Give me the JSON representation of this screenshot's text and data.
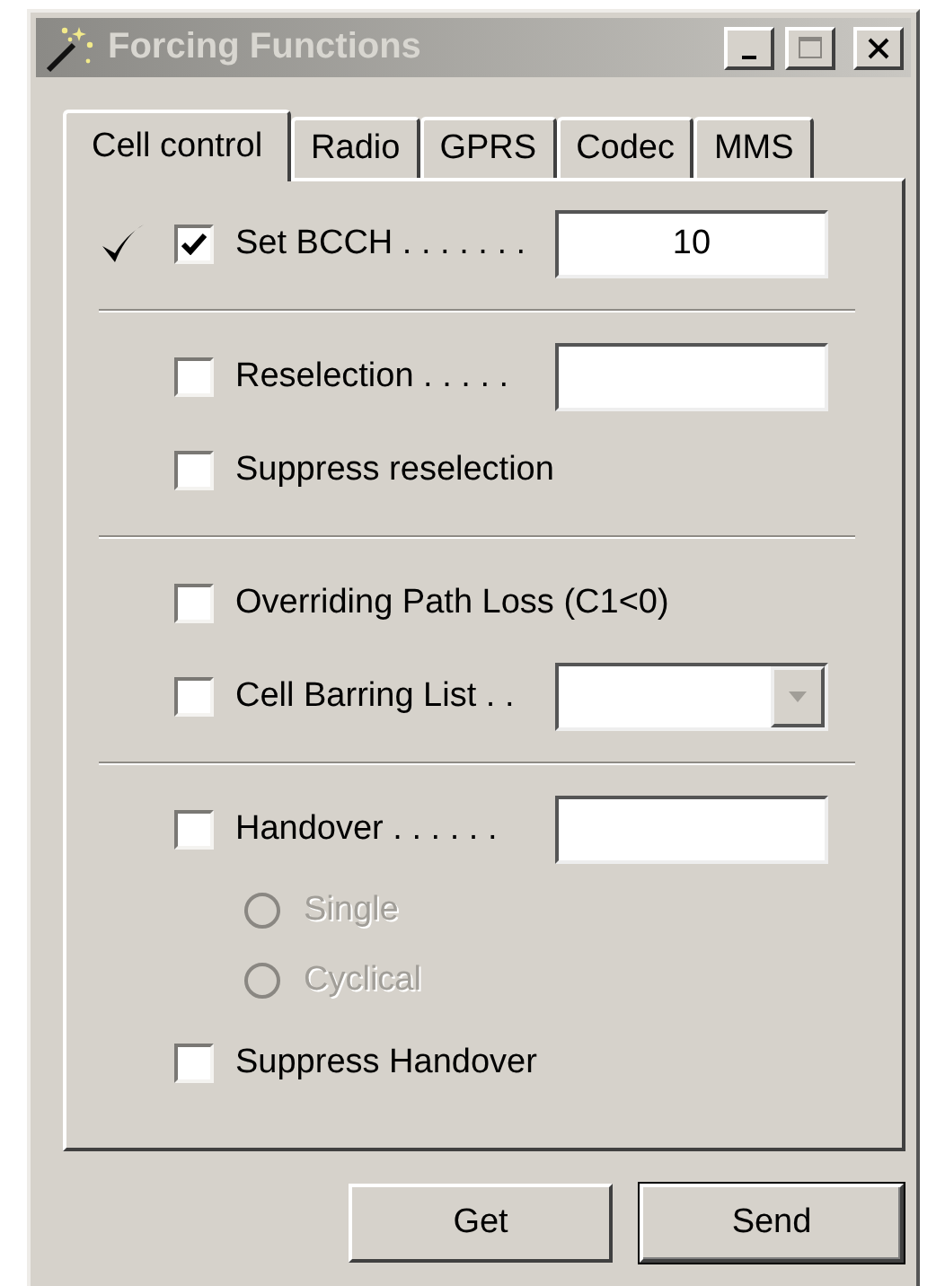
{
  "window": {
    "title": "Forcing Functions",
    "active": false
  },
  "tabs": [
    {
      "label": "Cell control",
      "selected": true
    },
    {
      "label": "Radio",
      "selected": false
    },
    {
      "label": "GPRS",
      "selected": false
    },
    {
      "label": "Codec",
      "selected": false
    },
    {
      "label": "MMS",
      "selected": false
    }
  ],
  "sections": [
    {
      "rows": [
        {
          "kind": "field",
          "applied": true,
          "checked": true,
          "label": "Set BCCH . . . . . . .",
          "value": "10"
        }
      ]
    },
    {
      "rows": [
        {
          "kind": "field",
          "applied": false,
          "checked": false,
          "label": "Reselection . . . . ."
        },
        {
          "kind": "checkbox",
          "applied": false,
          "checked": false,
          "label": "Suppress reselection"
        }
      ]
    },
    {
      "rows": [
        {
          "kind": "checkbox",
          "applied": false,
          "checked": false,
          "label": "Overriding Path Loss (C1<0)"
        },
        {
          "kind": "combo",
          "applied": false,
          "checked": false,
          "label": "Cell Barring List . ."
        }
      ]
    },
    {
      "rows": [
        {
          "kind": "field",
          "applied": false,
          "checked": false,
          "label": "Handover . . . . . ."
        },
        {
          "kind": "radio",
          "disabled": true,
          "selected": false,
          "label": "Single"
        },
        {
          "kind": "radio",
          "disabled": true,
          "selected": false,
          "label": "Cyclical"
        },
        {
          "kind": "checkbox",
          "applied": false,
          "checked": false,
          "label": "Suppress Handover"
        }
      ]
    }
  ],
  "buttons": [
    {
      "label": "Get",
      "default": false
    },
    {
      "label": "Send",
      "default": true
    }
  ]
}
